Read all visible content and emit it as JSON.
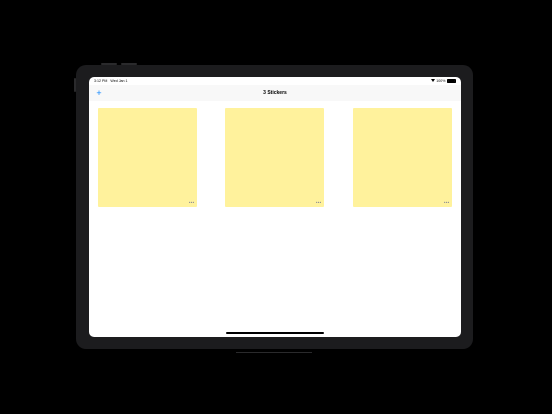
{
  "status_bar": {
    "time": "3:12 PM",
    "date": "Wed Jan 1",
    "battery": "100%"
  },
  "navbar": {
    "title": "3 Stickers",
    "add_label": "+"
  },
  "stickers": [
    {
      "color": "#fff29c",
      "more_label": "•••"
    },
    {
      "color": "#fff29c",
      "more_label": "•••"
    },
    {
      "color": "#fff29c",
      "more_label": "•••"
    }
  ]
}
